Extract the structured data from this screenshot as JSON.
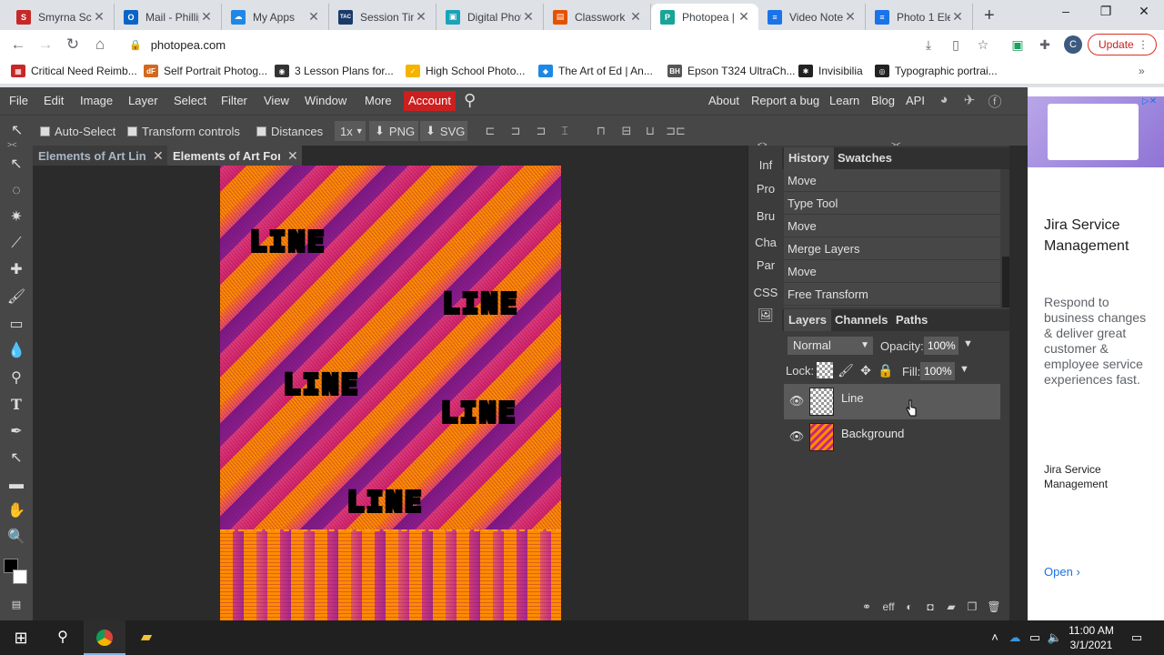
{
  "browser": {
    "tabs": [
      {
        "title": "Smyrna Sch",
        "color": "#c62828",
        "glyph": "S"
      },
      {
        "title": "Mail - Phillip",
        "color": "#0a64c8",
        "glyph": "O"
      },
      {
        "title": "My Apps",
        "color": "#1e88e5",
        "glyph": "☁"
      },
      {
        "title": "Session Tim",
        "color": "#1a3a6b",
        "glyph": "TAC"
      },
      {
        "title": "Digital Phot",
        "color": "#1aa3b8",
        "glyph": "▣"
      },
      {
        "title": "Classwork f",
        "color": "#e65100",
        "glyph": "▤"
      },
      {
        "title": "Photopea |",
        "color": "#18a497",
        "glyph": "P"
      },
      {
        "title": "Video Note",
        "color": "#1a73e8",
        "glyph": "≡"
      },
      {
        "title": "Photo 1 Ele",
        "color": "#1a73e8",
        "glyph": "≡"
      }
    ],
    "new_tab": "+",
    "url": "photopea.com",
    "profile_initial": "C",
    "update_label": "Update",
    "bookmarks": [
      {
        "label": "Critical Need Reimb...",
        "color": "#c62828",
        "glyph": "▦"
      },
      {
        "label": "Self Portrait Photog...",
        "color": "#d2691e",
        "glyph": "dF"
      },
      {
        "label": "3 Lesson Plans for...",
        "color": "#333333",
        "glyph": "◉"
      },
      {
        "label": "High School Photo...",
        "color": "#f4b400",
        "glyph": "✓"
      },
      {
        "label": "The Art of Ed | An...",
        "color": "#1e88e5",
        "glyph": "◆"
      },
      {
        "label": "Epson T324 UltraCh...",
        "color": "#555555",
        "glyph": "BH"
      },
      {
        "label": "Invisibilia",
        "color": "#222222",
        "glyph": "✱"
      },
      {
        "label": "Typographic portrai...",
        "color": "#222222",
        "glyph": "◎"
      }
    ],
    "bookmarks_more": "»"
  },
  "photopea": {
    "menu": [
      "File",
      "Edit",
      "Image",
      "Layer",
      "Select",
      "Filter",
      "View",
      "Window",
      "More"
    ],
    "account_label": "Account",
    "right_menu": [
      "About",
      "Report a bug",
      "Learn",
      "Blog",
      "API"
    ],
    "options": {
      "auto_select": "Auto-Select",
      "transform_controls": "Transform controls",
      "distances": "Distances",
      "zoom": "1x",
      "png": "PNG",
      "svg": "SVG"
    },
    "doc_tabs": [
      {
        "title": "Elements of Art Lin"
      },
      {
        "title": "Elements of Art For"
      }
    ],
    "canvas_words": [
      "LINE",
      "LINE",
      "LINE",
      "LINE",
      "LINE"
    ],
    "side_panels": [
      "Inf",
      "Pro",
      "Bru",
      "Cha",
      "Par",
      "CSS"
    ],
    "panel_tabs_top": [
      "History",
      "Swatches"
    ],
    "history": [
      "Move",
      "Type Tool",
      "Move",
      "Merge Layers",
      "Move",
      "Free Transform"
    ],
    "panel_tabs_bottom": [
      "Layers",
      "Channels",
      "Paths"
    ],
    "blend_mode": "Normal",
    "opacity_label": "Opacity:",
    "opacity_value": "100%",
    "lock_label": "Lock:",
    "fill_label": "Fill:",
    "fill_value": "100%",
    "layers": [
      {
        "name": "Line",
        "selected": true
      },
      {
        "name": "Background",
        "selected": false
      }
    ],
    "footer_eff": "eff"
  },
  "ad": {
    "title": "Jira Service Management",
    "body": "Respond to business changes & deliver great customer & employee service experiences fast.",
    "brand": "Jira Service Management",
    "open_label": "Open"
  },
  "taskbar": {
    "time": "11:00 AM",
    "date": "3/1/2021"
  }
}
